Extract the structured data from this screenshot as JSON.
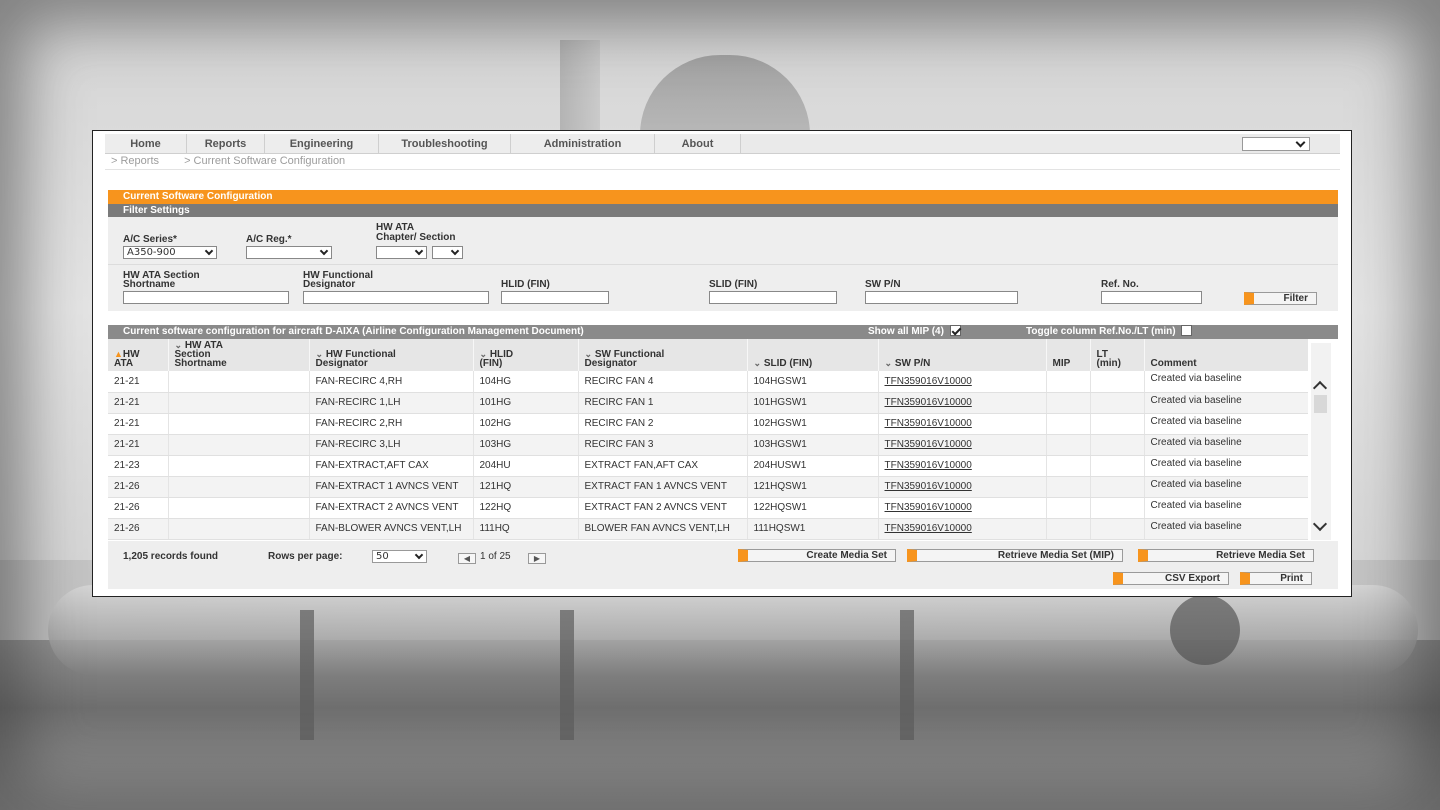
{
  "menu": {
    "items": [
      "Home",
      "Reports",
      "Engineering",
      "Troubleshooting",
      "Administration",
      "About"
    ],
    "language_value": ""
  },
  "breadcrumb": [
    "> Reports",
    "> Current Software Configuration"
  ],
  "panel_title": "Current Software Configuration",
  "filter": {
    "title": "Filter Settings",
    "ac_series_label": "A/C Series*",
    "ac_series_value": "A350-900",
    "ac_reg_label": "A/C Reg.*",
    "ac_reg_value": "",
    "hw_ata_label_1": "HW ATA",
    "hw_ata_label_2": "Chapter/ Section",
    "hw_ata_section_shortname_1": "HW ATA Section",
    "hw_ata_section_shortname_2": "Shortname",
    "hw_functional_designator_1": "HW Functional",
    "hw_functional_designator_2": "Designator",
    "hlid_label": "HLID (FIN)",
    "slid_label": "SLID (FIN)",
    "swpn_label": "SW P/N",
    "refno_label": "Ref. No.",
    "filter_button": "Filter"
  },
  "results": {
    "title": "Current software configuration for aircraft D-AIXA (Airline Configuration Management Document)",
    "show_all_mip": "Show all MIP (4)",
    "toggle_column": "Toggle column Ref.No./LT (min)",
    "columns": [
      [
        "HW",
        "ATA"
      ],
      [
        "HW ATA",
        "Section",
        "Shortname"
      ],
      [
        "HW Functional",
        "Designator"
      ],
      [
        "HLID",
        "(FIN)"
      ],
      [
        "SW Functional",
        "Designator"
      ],
      [
        "SLID (FIN)"
      ],
      [
        "SW P/N"
      ],
      [
        "MIP"
      ],
      [
        "LT",
        "(min)"
      ],
      [
        "Comment"
      ]
    ],
    "rows": [
      {
        "ata": "21-21",
        "shortname": "",
        "hw_fd": "FAN-RECIRC 4,RH",
        "hlid": "104HG",
        "sw_fd": "RECIRC FAN 4",
        "slid": "104HGSW1",
        "swpn": "TFN359016V10000",
        "mip": "",
        "lt": "",
        "comment": "Created via baseline"
      },
      {
        "ata": "21-21",
        "shortname": "",
        "hw_fd": "FAN-RECIRC 1,LH",
        "hlid": "101HG",
        "sw_fd": "RECIRC FAN 1",
        "slid": "101HGSW1",
        "swpn": "TFN359016V10000",
        "mip": "",
        "lt": "",
        "comment": "Created via baseline"
      },
      {
        "ata": "21-21",
        "shortname": "",
        "hw_fd": "FAN-RECIRC 2,RH",
        "hlid": "102HG",
        "sw_fd": "RECIRC FAN 2",
        "slid": "102HGSW1",
        "swpn": "TFN359016V10000",
        "mip": "",
        "lt": "",
        "comment": "Created via baseline"
      },
      {
        "ata": "21-21",
        "shortname": "",
        "hw_fd": "FAN-RECIRC 3,LH",
        "hlid": "103HG",
        "sw_fd": "RECIRC FAN 3",
        "slid": "103HGSW1",
        "swpn": "TFN359016V10000",
        "mip": "",
        "lt": "",
        "comment": "Created via baseline"
      },
      {
        "ata": "21-23",
        "shortname": "",
        "hw_fd": "FAN-EXTRACT,AFT CAX",
        "hlid": "204HU",
        "sw_fd": "EXTRACT FAN,AFT CAX",
        "slid": "204HUSW1",
        "swpn": "TFN359016V10000",
        "mip": "",
        "lt": "",
        "comment": "Created via baseline"
      },
      {
        "ata": "21-26",
        "shortname": "",
        "hw_fd": "FAN-EXTRACT 1 AVNCS VENT",
        "hlid": "121HQ",
        "sw_fd": "EXTRACT FAN 1 AVNCS VENT",
        "slid": "121HQSW1",
        "swpn": "TFN359016V10000",
        "mip": "",
        "lt": "",
        "comment": "Created via baseline"
      },
      {
        "ata": "21-26",
        "shortname": "",
        "hw_fd": "FAN-EXTRACT 2 AVNCS VENT",
        "hlid": "122HQ",
        "sw_fd": "EXTRACT FAN 2 AVNCS VENT",
        "slid": "122HQSW1",
        "swpn": "TFN359016V10000",
        "mip": "",
        "lt": "",
        "comment": "Created via baseline"
      },
      {
        "ata": "21-26",
        "shortname": "",
        "hw_fd": "FAN-BLOWER AVNCS VENT,LH",
        "hlid": "111HQ",
        "sw_fd": "BLOWER FAN AVNCS VENT,LH",
        "slid": "111HQSW1",
        "swpn": "TFN359016V10000",
        "mip": "",
        "lt": "",
        "comment": "Created via baseline"
      }
    ]
  },
  "footer": {
    "records_found": "1,205 records found",
    "rows_per_page_label": "Rows per page:",
    "rows_per_page_value": "50",
    "page_text": "1 of 25",
    "create_media_set": "Create Media Set",
    "retrieve_media_set_mip": "Retrieve Media Set (MIP)",
    "retrieve_media_set": "Retrieve Media Set",
    "csv_export": "CSV Export",
    "print": "Print"
  },
  "colors": {
    "accent_orange": "#f7941d",
    "header_gray": "#7a7a7a"
  }
}
